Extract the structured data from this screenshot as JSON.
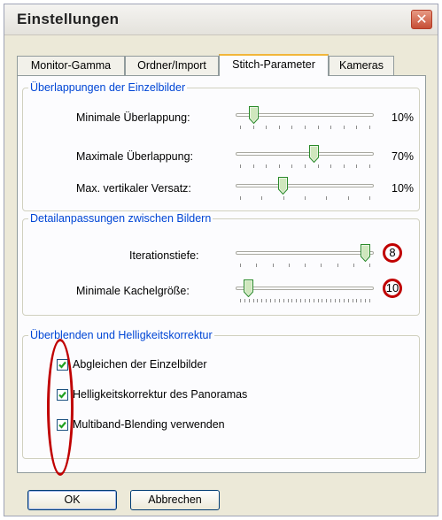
{
  "window": {
    "title": "Einstellungen",
    "close_symbol": "✕"
  },
  "tabs": [
    {
      "label": "Monitor-Gamma",
      "active": false
    },
    {
      "label": "Ordner/Import",
      "active": false
    },
    {
      "label": "Stitch-Parameter",
      "active": true
    },
    {
      "label": "Kameras",
      "active": false
    }
  ],
  "overlap_group": {
    "title": "Überlappungen der Einzelbilder",
    "sliders": [
      {
        "label": "Minimale Überlappung:",
        "value": "10%",
        "position": 0.1
      },
      {
        "label": "Maximale Überlappung:",
        "value": "70%",
        "position": 0.57
      },
      {
        "label": "Max. vertikaler Versatz:",
        "value": "10%",
        "position": 0.33
      }
    ]
  },
  "detail_group": {
    "title": "Detailanpassungen zwischen Bildern",
    "sliders": [
      {
        "label": "Iterationstiefe:",
        "value": "8",
        "position": 0.97
      },
      {
        "label": "Minimale Kachelgröße:",
        "value": "10",
        "position": 0.06
      }
    ]
  },
  "blend_group": {
    "title": "Überblenden und Helligkeitskorrektur",
    "checkboxes": [
      {
        "label": "Abgleichen der Einzelbilder",
        "checked": true
      },
      {
        "label": "Helligkeitskorrektur des Panoramas",
        "checked": true
      },
      {
        "label": "Multiband-Blending verwenden",
        "checked": true
      }
    ]
  },
  "buttons": {
    "ok": "OK",
    "cancel": "Abbrechen"
  },
  "colors": {
    "annotation": "#c00000",
    "group_title": "#0046d5",
    "check": "#21a121"
  }
}
